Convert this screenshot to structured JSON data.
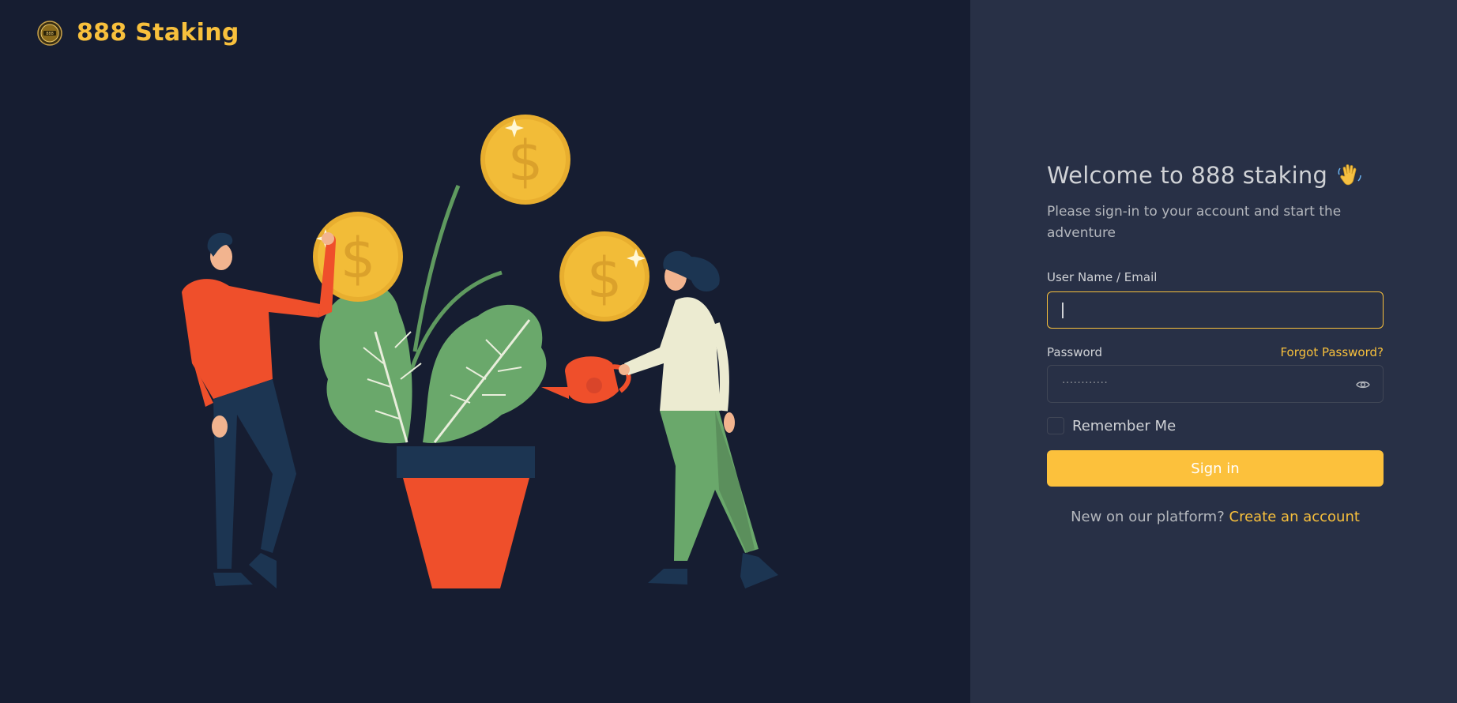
{
  "brand": {
    "name": "888 Staking",
    "logo_icon": "coin-logo-icon"
  },
  "illustration": {
    "icon": "money-plant-illustration"
  },
  "login": {
    "title": "Welcome to 888 staking",
    "title_icon": "waving-hand-icon",
    "subtitle": "Please sign-in to your account and start the adventure",
    "username_label": "User Name / Email",
    "username_value": "",
    "password_label": "Password",
    "password_masked": "............",
    "forgot_password": "Forgot Password?",
    "remember_me": "Remember Me",
    "remember_checked": false,
    "sign_in": "Sign in",
    "signup_prompt": "New on our platform?",
    "create_account": "Create an account"
  },
  "colors": {
    "accent": "#f8c03c",
    "left_bg": "#161d31",
    "right_bg": "#283046",
    "text": "#d0d2d6"
  }
}
